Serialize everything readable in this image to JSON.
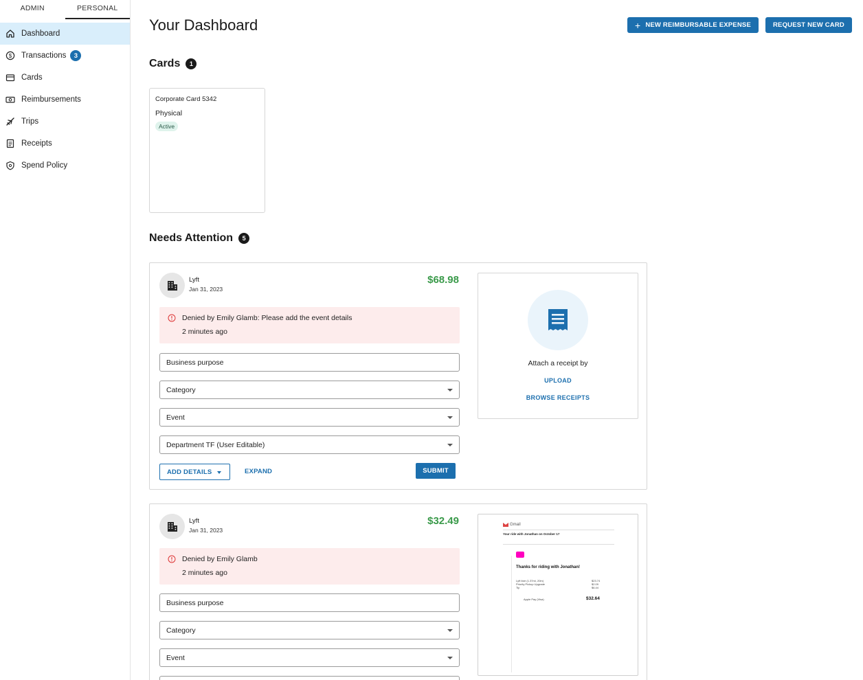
{
  "sidebar": {
    "tabs": [
      {
        "label": "ADMIN"
      },
      {
        "label": "PERSONAL"
      }
    ],
    "items": [
      {
        "label": "Dashboard",
        "icon": "home-icon"
      },
      {
        "label": "Transactions",
        "icon": "dollar-circle-icon",
        "badge": "3"
      },
      {
        "label": "Cards",
        "icon": "card-icon"
      },
      {
        "label": "Reimbursements",
        "icon": "cash-icon"
      },
      {
        "label": "Trips",
        "icon": "plane-icon"
      },
      {
        "label": "Receipts",
        "icon": "receipt-icon"
      },
      {
        "label": "Spend Policy",
        "icon": "shield-icon"
      }
    ]
  },
  "header": {
    "title": "Your Dashboard",
    "new_expense_label": "NEW REIMBURSABLE EXPENSE",
    "request_card_label": "REQUEST NEW CARD"
  },
  "cards_section": {
    "title": "Cards",
    "count": "1",
    "cards": [
      {
        "name": "Corporate Card 5342",
        "type": "Physical",
        "status": "Active"
      }
    ]
  },
  "attention": {
    "title": "Needs Attention",
    "count": "5",
    "items": [
      {
        "merchant": "Lyft",
        "date": "Jan 31, 2023",
        "amount": "$68.98",
        "denial": "Denied by Emily Glamb: Please add the event details",
        "denial_time": "2 minutes ago",
        "fields": {
          "purpose": "Business purpose",
          "category": "Category",
          "event": "Event",
          "department": "Department TF (User Editable)"
        },
        "add_details": "ADD DETAILS",
        "expand": "EXPAND",
        "submit": "SUBMIT",
        "receipt": {
          "attach_text": "Attach a receipt by",
          "upload": "UPLOAD",
          "browse": "BROWSE RECEIPTS"
        }
      },
      {
        "merchant": "Lyft",
        "date": "Jan 31, 2023",
        "amount": "$32.49",
        "denial": "Denied by Emily Glamb",
        "denial_time": "2 minutes ago",
        "fields": {
          "purpose": "Business purpose",
          "category": "Category",
          "event": "Event"
        },
        "receipt_image": {
          "app": "Gmail",
          "subject": "Your ride with Jonathan on October 17",
          "headline": "Thanks for riding with Jonathan!",
          "total": "$32.64",
          "payment": "Apple Pay (Visa)",
          "lines": [
            {
              "label": "Lyft fare (1.37mi, 20m)",
              "value": "$23.74"
            },
            {
              "label": "Priority Pickup Upgrade",
              "value": "$2.09"
            },
            {
              "label": "Tip",
              "value": "$6.44"
            }
          ]
        }
      }
    ]
  },
  "colors": {
    "accent": "#1c6fae",
    "active_nav": "#d9eefb",
    "amount_green": "#3a9a4a",
    "denial_bg": "#fdecec",
    "status_bg": "#dff3ec"
  }
}
